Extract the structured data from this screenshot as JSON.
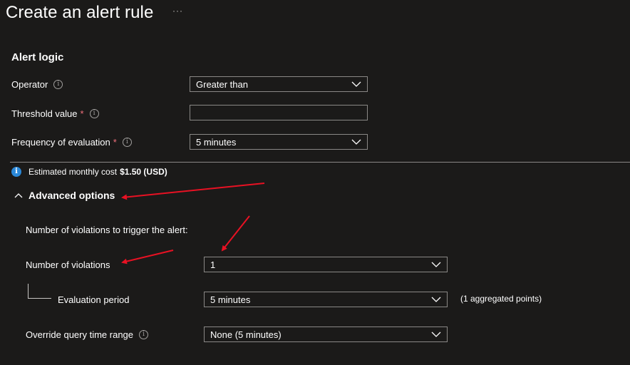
{
  "header": {
    "title": "Create an alert rule",
    "more_label": "···"
  },
  "alert_logic": {
    "section_title": "Alert logic",
    "operator": {
      "label": "Operator",
      "value": "Greater than"
    },
    "threshold": {
      "label": "Threshold value",
      "required_mark": "*",
      "value": ""
    },
    "frequency": {
      "label": "Frequency of evaluation",
      "required_mark": "*",
      "value": "5 minutes"
    }
  },
  "cost": {
    "text": "Estimated monthly cost",
    "amount": "$1.50 (USD)"
  },
  "advanced": {
    "label": "Advanced options",
    "violations_heading": "Number of violations to trigger the alert:",
    "num_violations": {
      "label": "Number of violations",
      "value": "1"
    },
    "evaluation_period": {
      "label": "Evaluation period",
      "value": "5 minutes",
      "note": "(1 aggregated points)"
    },
    "override_range": {
      "label": "Override query time range",
      "value": "None (5 minutes)"
    }
  },
  "colors": {
    "background": "#1b1a19",
    "required": "#f1707b",
    "info": "#2b88d8",
    "annotation_arrow": "#e81123"
  }
}
